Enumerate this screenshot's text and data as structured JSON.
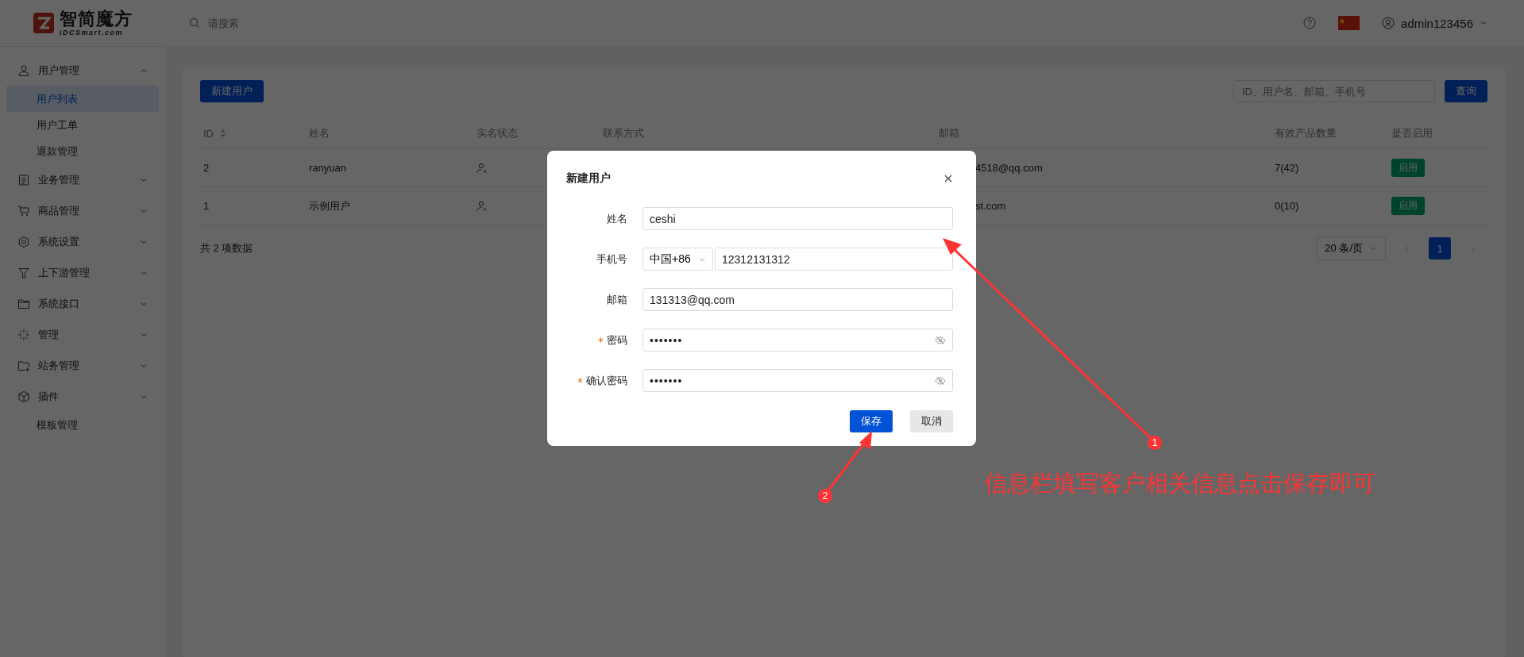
{
  "header": {
    "logo": {
      "name": "智简魔方",
      "subtitle": "iDCSmart.com"
    },
    "search": {
      "placeholder": "请搜索"
    },
    "user": "admin123456"
  },
  "sidebar": {
    "items": [
      {
        "label": "用户管理",
        "kind": "group",
        "expanded": true,
        "children": [
          {
            "label": "用户列表",
            "selected": true
          },
          {
            "label": "用户工单",
            "selected": false
          },
          {
            "label": "退款管理",
            "selected": false
          }
        ]
      },
      {
        "label": "业务管理",
        "kind": "group",
        "expanded": false
      },
      {
        "label": "商品管理",
        "kind": "group",
        "expanded": false
      },
      {
        "label": "系统设置",
        "kind": "group",
        "expanded": false
      },
      {
        "label": "上下游管理",
        "kind": "group",
        "expanded": false
      },
      {
        "label": "系统接口",
        "kind": "group",
        "expanded": false
      },
      {
        "label": "管理",
        "kind": "group",
        "expanded": false
      },
      {
        "label": "站务管理",
        "kind": "group",
        "expanded": false
      },
      {
        "label": "插件",
        "kind": "group",
        "expanded": false
      },
      {
        "label": "模板管理",
        "kind": "plain"
      }
    ]
  },
  "toolbar": {
    "new_button": "新建用户",
    "search": {
      "placeholder": "ID、用户名、邮箱、手机号"
    },
    "query_button": "查询"
  },
  "table": {
    "columns": [
      {
        "label": "ID",
        "sortable": true
      },
      {
        "label": "姓名",
        "sortable": false
      },
      {
        "label": "实名状态",
        "sortable": false
      },
      {
        "label": "联系方式",
        "sortable": false
      },
      {
        "label": "邮箱",
        "sortable": false
      },
      {
        "label": "有效产品数量",
        "sortable": false
      },
      {
        "label": "是否启用",
        "sortable": false
      }
    ],
    "rows": [
      {
        "id": "2",
        "name": "ranyuan",
        "verified": false,
        "email": "4518@qq.com",
        "products": "7(42)",
        "status": "启用",
        "enabled": true
      },
      {
        "id": "1",
        "name": "示例用户",
        "verified": false,
        "email": "st.com",
        "products": "0(10)",
        "status": "启用",
        "enabled": true
      }
    ]
  },
  "pagination": {
    "total": "共 2 项数据",
    "page_size": "20 条/页",
    "pages": [
      {
        "label": "1",
        "selected": true
      }
    ]
  },
  "dialog": {
    "title": "新建用户",
    "fields": [
      {
        "label": "姓名",
        "kind": "text",
        "required": false,
        "value": "ceshi"
      },
      {
        "label": "手机号",
        "kind": "phone",
        "required": false,
        "prefix": "中国+86",
        "value": "12312131312"
      },
      {
        "label": "邮箱",
        "kind": "text",
        "required": false,
        "value": "131313@qq.com"
      },
      {
        "label": "密码",
        "kind": "password",
        "required": true,
        "value": "•••••••"
      },
      {
        "label": "确认密码",
        "kind": "password",
        "required": true,
        "value": "•••••••"
      }
    ],
    "save_button": "保存",
    "cancel_button": "取消"
  },
  "annotations": {
    "markers": [
      "1",
      "2"
    ],
    "note": "信息栏填写客户相关信息点击保存即可"
  }
}
